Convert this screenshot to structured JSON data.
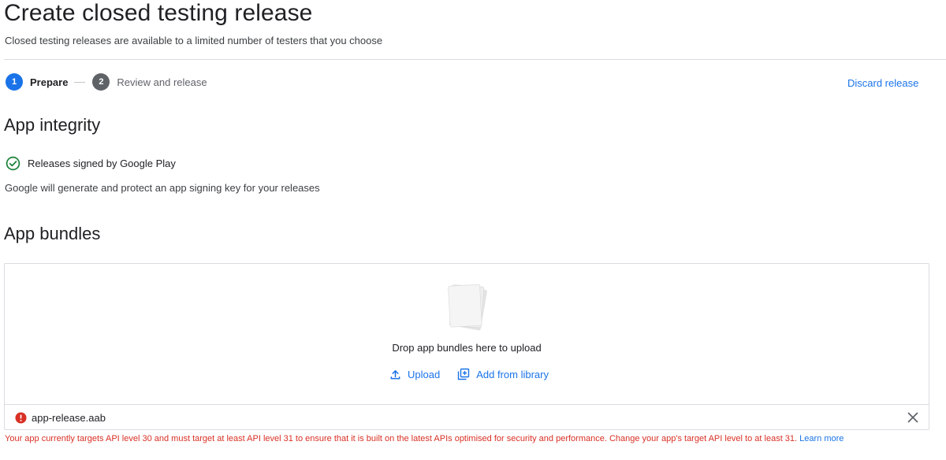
{
  "header": {
    "title": "Create closed testing release",
    "subtitle": "Closed testing releases are available to a limited number of testers that you choose"
  },
  "stepper": {
    "steps": [
      {
        "number": "1",
        "label": "Prepare"
      },
      {
        "number": "2",
        "label": "Review and release"
      }
    ],
    "discard_label": "Discard release"
  },
  "app_integrity": {
    "title": "App integrity",
    "status_label": "Releases signed by Google Play",
    "description": "Google will generate and protect an app signing key for your releases"
  },
  "app_bundles": {
    "title": "App bundles",
    "drop_text": "Drop app bundles here to upload",
    "upload_label": "Upload",
    "library_label": "Add from library",
    "file_name": "app-release.aab",
    "error_message": "Your app currently targets API level 30 and must target at least API level 31 to ensure that it is built on the latest APIs optimised for security and performance. Change your app's target API level to at least 31.",
    "learn_more_label": "Learn more"
  },
  "colors": {
    "accent": "#1a73e8",
    "success": "#188038",
    "error": "#d93025"
  }
}
